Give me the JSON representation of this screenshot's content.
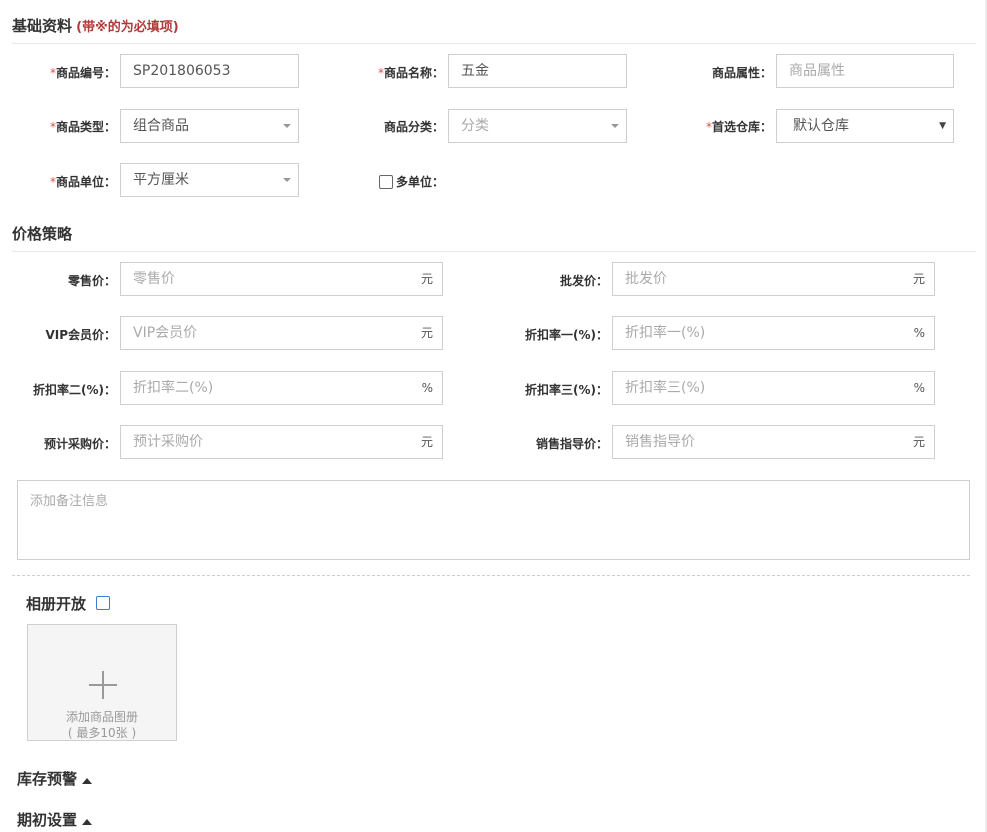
{
  "basic": {
    "title": "基础资料",
    "note": "(带※的为必填项)",
    "product_code": {
      "label": "商品编号：",
      "value": "SP201806053"
    },
    "product_name": {
      "label": "商品名称：",
      "value": "五金"
    },
    "product_attr": {
      "label": "商品属性：",
      "placeholder": "商品属性"
    },
    "product_type": {
      "label": "商品类型：",
      "value": "组合商品"
    },
    "product_category": {
      "label": "商品分类：",
      "value": "分类"
    },
    "warehouse": {
      "label": "首选仓库：",
      "value": "默认仓库"
    },
    "unit": {
      "label": "商品单位：",
      "value": "平方厘米"
    },
    "multi_unit": {
      "label": "多单位："
    },
    "required_mark": "*"
  },
  "pricing": {
    "title": "价格策略",
    "retail": {
      "label": "零售价：",
      "placeholder": "零售价",
      "suffix": "元"
    },
    "wholesale": {
      "label": "批发价：",
      "placeholder": "批发价",
      "suffix": "元"
    },
    "vip": {
      "label": "VIP会员价：",
      "placeholder": "VIP会员价",
      "suffix": "元"
    },
    "discount1": {
      "label": "折扣率一(%)：",
      "placeholder": "折扣率一(%)",
      "suffix": "%"
    },
    "discount2": {
      "label": "折扣率二(%)：",
      "placeholder": "折扣率二(%)",
      "suffix": "%"
    },
    "discount3": {
      "label": "折扣率三(%)：",
      "placeholder": "折扣率三(%)",
      "suffix": "%"
    },
    "purchase": {
      "label": "预计采购价：",
      "placeholder": "预计采购价",
      "suffix": "元"
    },
    "guide": {
      "label": "销售指导价：",
      "placeholder": "销售指导价",
      "suffix": "元"
    }
  },
  "remark": {
    "placeholder": "添加备注信息"
  },
  "album": {
    "title": "相册开放",
    "upload_line1": "添加商品图册",
    "upload_line2": "( 最多10张 )"
  },
  "stock_alert": {
    "title": "库存预警"
  },
  "initial": {
    "title": "期初设置"
  }
}
